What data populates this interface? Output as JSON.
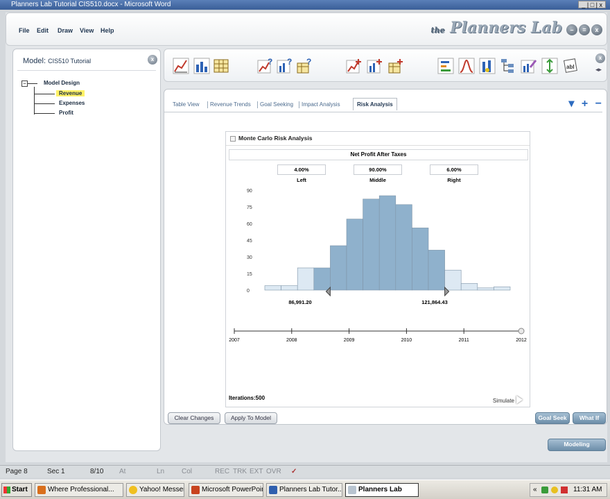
{
  "window": {
    "title": "Planners Lab Tutorial CIS510.docx - Microsoft Word",
    "controls": "_ | □ | x"
  },
  "menu": [
    "File",
    "Edit",
    "Draw",
    "View",
    "Help"
  ],
  "logo": {
    "prefix": "the",
    "name": "Planners Lab"
  },
  "model": {
    "label": "Model:",
    "name": "CIS510 Tutorial"
  },
  "tree": {
    "root": "Model Design",
    "items": [
      "Revenue",
      "Expenses",
      "Profit"
    ],
    "selected": "Revenue",
    "expander": "−"
  },
  "toolbar_icons": [
    "line-chart-icon",
    "bar-chart-icon",
    "table-icon",
    "goal-seek-line-icon",
    "goal-seek-bar-icon",
    "goal-seek-table-icon",
    "impact-line-icon",
    "impact-bar-icon",
    "impact-table-icon",
    "grid-chart-icon",
    "risk-chart-icon",
    "bar-alert-icon",
    "hierarchy-icon",
    "edit-chart-icon",
    "move-chart-icon",
    "label-icon"
  ],
  "tabs": [
    "Table View",
    "Revenue Trends",
    "Goal Seeking",
    "Impact Analysis",
    "Risk Analysis"
  ],
  "active_tab": "Risk Analysis",
  "tab_controls": "▾ + −",
  "monte_carlo": {
    "title": "Monte Carlo Risk Analysis",
    "subtitle": "Net Profit After Taxes",
    "left": {
      "value": "4.00%",
      "label": "Left"
    },
    "middle": {
      "value": "90.00%",
      "label": "Middle"
    },
    "right": {
      "value": "6.00%",
      "label": "Right"
    },
    "lower_marker": "86,991.20",
    "upper_marker": "121,864.43",
    "iterations": "Iterations:500",
    "simulate": "Simulate"
  },
  "chart_data": {
    "type": "bar",
    "title": "Net Profit After Taxes",
    "yticks": [
      0,
      15,
      30,
      45,
      60,
      75,
      90
    ],
    "ylim": [
      0,
      90
    ],
    "values": [
      4,
      4,
      20,
      20,
      40,
      64,
      82,
      85,
      77,
      56,
      36,
      18,
      6,
      2,
      3
    ],
    "region": [
      "tail",
      "tail",
      "tail",
      "mid",
      "mid",
      "mid",
      "mid",
      "mid",
      "mid",
      "mid",
      "mid",
      "tail",
      "tail",
      "tail",
      "tail"
    ],
    "xticks": [
      "2007",
      "2008",
      "2009",
      "2010",
      "2011",
      "2012"
    ],
    "colors": {
      "mid": "#8fb1cc",
      "tail": "#dde9f3",
      "edge": "#7f95a8"
    }
  },
  "buttons": {
    "clear": "Clear Changes",
    "apply": "Apply To Model",
    "goal_seek": "Goal Seek",
    "what_if": "What If",
    "modeling": "Modeling"
  },
  "status": {
    "page": "Page 8",
    "sec": "Sec 1",
    "pages": "8/10",
    "at": "At",
    "ln": "Ln",
    "col": "Col",
    "rec": "REC",
    "trk": "TRK",
    "ext": "EXT",
    "ovr": "OVR"
  },
  "taskbar": {
    "start": "Start",
    "tasks": [
      "Where Professional...",
      "Yahoo! Messenger",
      "Microsoft PowerPoint",
      "Planners Lab Tutor...",
      "Planners Lab"
    ],
    "time": "11:31 AM",
    "tray_prefix": "«"
  }
}
